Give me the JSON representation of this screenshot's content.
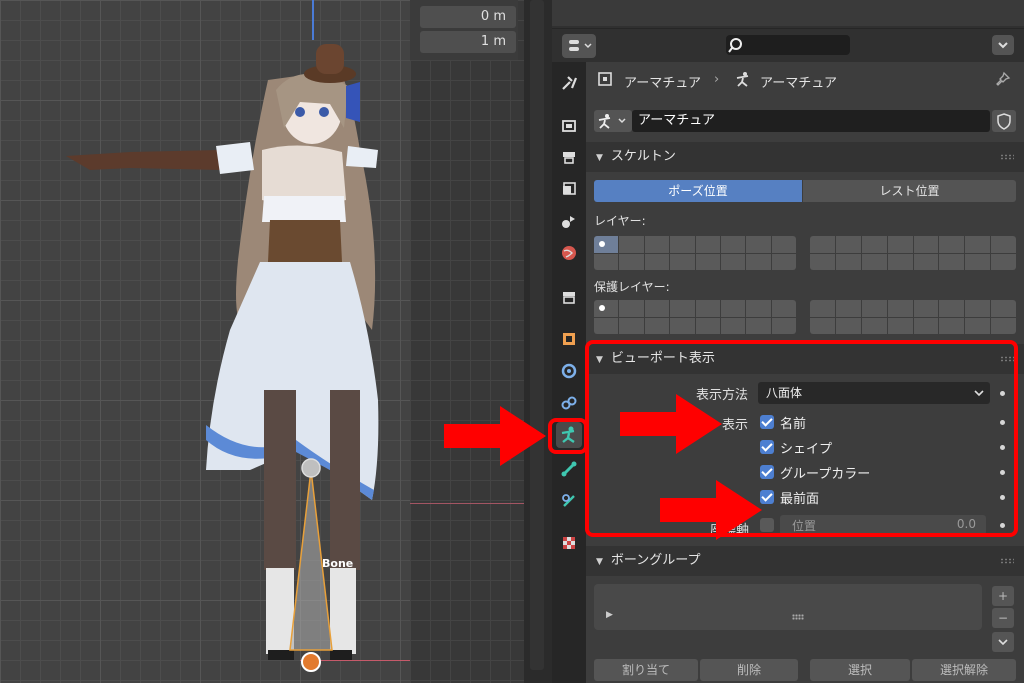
{
  "viewport": {
    "coord_readouts": [
      "0 m",
      "1 m"
    ],
    "bone_label": "Bone"
  },
  "properties": {
    "breadcrumb": {
      "object": "アーマチュア",
      "data": "アーマチュア"
    },
    "datablock_name": "アーマチュア",
    "skeleton": {
      "header": "スケルトン",
      "pose_position": "ポーズ位置",
      "rest_position": "レスト位置",
      "layers_label": "レイヤー:",
      "protected_layers_label": "保護レイヤー:"
    },
    "viewport_display": {
      "header": "ビューポート表示",
      "display_as_label": "表示方法",
      "display_as_value": "八面体",
      "show_label": "表示",
      "names_label": "名前",
      "names_checked": true,
      "shapes_label": "シェイプ",
      "shapes_checked": true,
      "group_colors_label": "グループカラー",
      "group_colors_checked": true,
      "in_front_label": "最前面",
      "in_front_checked": true,
      "axes_label": "座標軸",
      "axes_checked": false,
      "position_label": "位置",
      "position_value": "0.0"
    },
    "bone_groups": {
      "header": "ボーングループ",
      "assign": "割り当て",
      "remove": "削除",
      "select": "選択",
      "deselect": "選択解除"
    }
  },
  "colors": {
    "accent_blue": "#5680c2",
    "annotation_red": "#ff0000",
    "active_tab_icon": "#3fc7b0"
  }
}
